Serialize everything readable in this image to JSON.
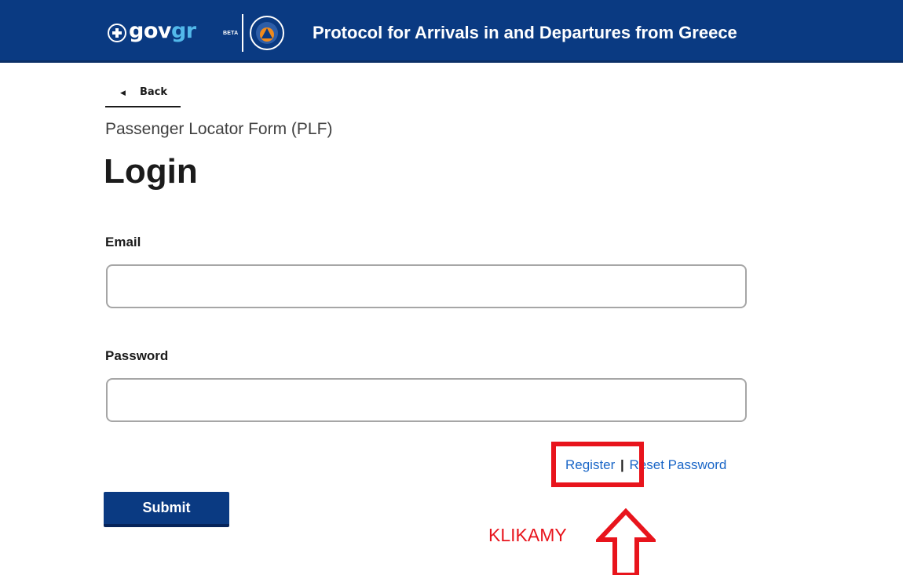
{
  "header": {
    "brand_gov": "gov",
    "brand_gr": "gr",
    "brand_beta": "BETA",
    "title": "Protocol for Arrivals in and Departures from Greece",
    "colors": {
      "bar": "#0a3a82",
      "brand_accent": "#52b8ea"
    }
  },
  "nav": {
    "back_label": "Back",
    "back_icon": "caret-left-icon"
  },
  "form": {
    "subtitle": "Passenger Locator Form (PLF)",
    "title": "Login",
    "email": {
      "label": "Email",
      "value": "",
      "placeholder": ""
    },
    "password": {
      "label": "Password",
      "value": "",
      "placeholder": ""
    },
    "links": {
      "register": "Register",
      "separator": "|",
      "reset": "Reset Password"
    },
    "submit_label": "Submit"
  },
  "annotation": {
    "text": "KLIKAMY",
    "color": "#e8141c",
    "arrow_icon": "up-arrow-outline-icon"
  }
}
